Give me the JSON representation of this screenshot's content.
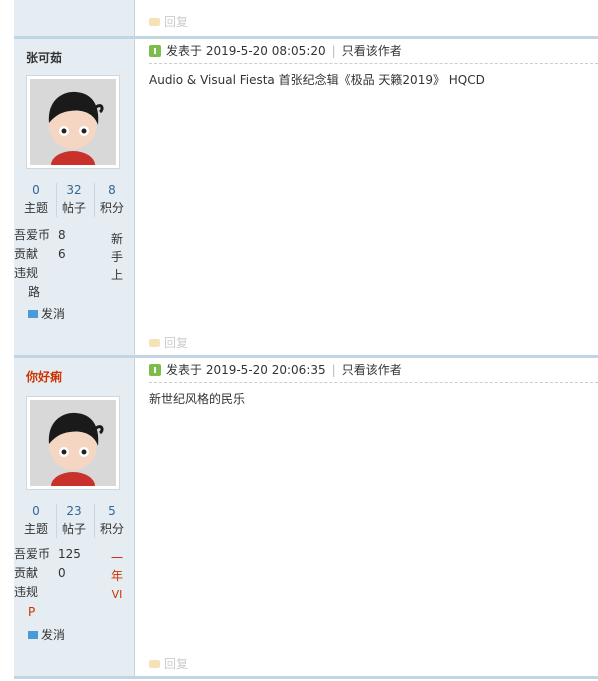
{
  "reply_label": "回复",
  "posts": [
    {
      "username": "张可茹",
      "username_color": "#333333",
      "stats": [
        {
          "value": "0",
          "label": "主题"
        },
        {
          "value": "32",
          "label": "帖子"
        },
        {
          "value": "8",
          "label": "积分"
        }
      ],
      "coins_label": "吾爱币",
      "coins": "8",
      "contrib_label": "贡献",
      "contrib": "6",
      "violation_label": "违规",
      "rank_chars": [
        "新",
        "手",
        "上",
        "路"
      ],
      "pm_label": "发消",
      "post_time": "发表于 2019-5-20 08:05:20",
      "author_only": "只看该作者",
      "content": "Audio & Visual Fiesta 首张纪念辑《极品 天籁2019》 HQCD"
    },
    {
      "username": "你好痢",
      "username_color": "#cc3300",
      "stats": [
        {
          "value": "0",
          "label": "主题"
        },
        {
          "value": "23",
          "label": "帖子"
        },
        {
          "value": "5",
          "label": "积分"
        }
      ],
      "coins_label": "吾爱币",
      "coins": "125",
      "contrib_label": "贡献",
      "contrib": "0",
      "violation_label": "违规",
      "rank_chars": [
        "一",
        "年",
        "VI",
        "P"
      ],
      "rank_color": "#cc3300",
      "pm_label": "发消",
      "post_time": "发表于 2019-5-20 20:06:35",
      "author_only": "只看该作者",
      "content": "新世纪风格的民乐"
    }
  ]
}
